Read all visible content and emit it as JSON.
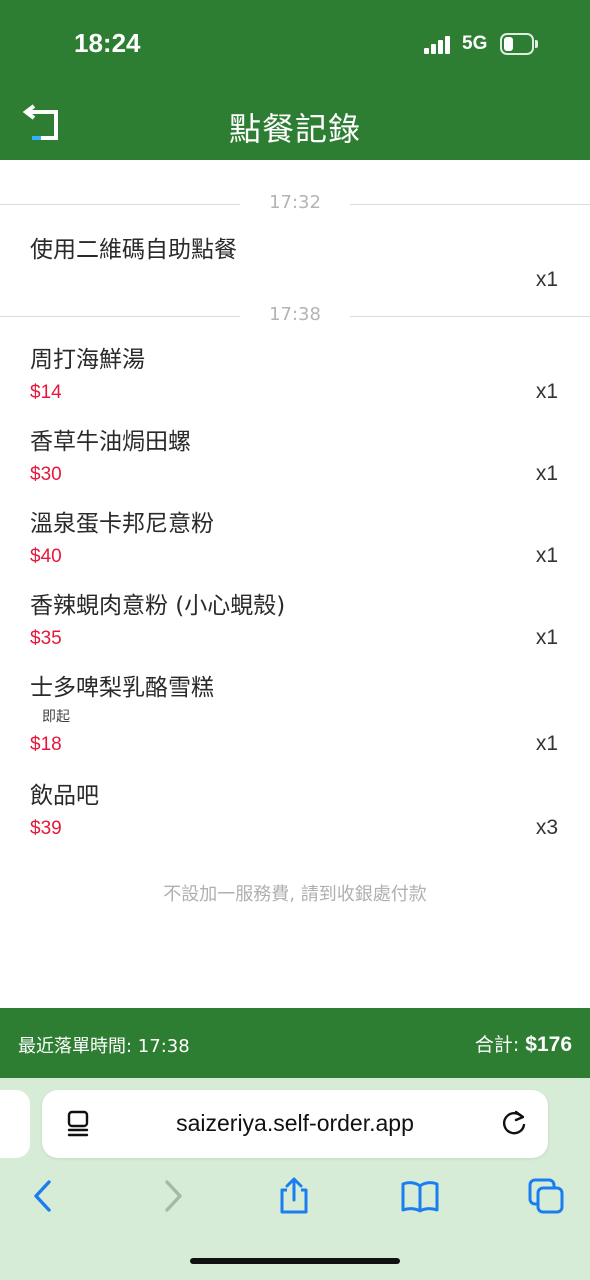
{
  "status_bar": {
    "time": "18:24",
    "network": "5G"
  },
  "header": {
    "title": "點餐記錄"
  },
  "groups": [
    {
      "time": "17:32",
      "items": [
        {
          "name": "使用二維碼自助點餐",
          "price": "",
          "qty": "x1"
        }
      ]
    },
    {
      "time": "17:38",
      "items": [
        {
          "name": "周打海鮮湯",
          "price": "$14",
          "qty": "x1"
        },
        {
          "name": "香草牛油焗田螺",
          "price": "$30",
          "qty": "x1"
        },
        {
          "name": "溫泉蛋卡邦尼意粉",
          "price": "$40",
          "qty": "x1"
        },
        {
          "name": "香辣蜆肉意粉 (小心蜆殼)",
          "price": "$35",
          "qty": "x1"
        },
        {
          "name": "士多啤梨乳酪雪糕",
          "note": "即起",
          "price": "$18",
          "qty": "x1"
        },
        {
          "name": "飲品吧",
          "price": "$39",
          "qty": "x3"
        }
      ]
    }
  ],
  "footnote": "不設加一服務費, 請到收銀處付款",
  "bottom_bar": {
    "last_order": "最近落單時間: 17:38",
    "total_label": "合計:",
    "total_value": "$176"
  },
  "browser": {
    "url": "saizeriya.self-order.app"
  },
  "colors": {
    "brand_green": "#2d7d32",
    "price_red": "#e5173b",
    "browser_bg": "#d7ecd6",
    "ios_blue": "#1a7ef0"
  },
  "icons": [
    "back-arrow-icon",
    "page-menu-icon",
    "reload-icon",
    "chevron-left-icon",
    "chevron-right-icon",
    "share-icon",
    "bookmarks-icon",
    "tabs-icon"
  ]
}
